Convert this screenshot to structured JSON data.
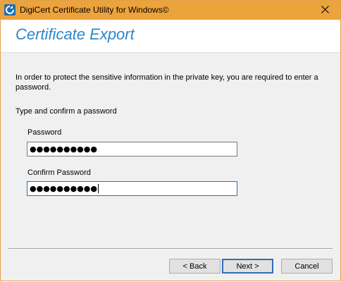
{
  "window": {
    "title": "DigiCert Certificate Utility for Windows©"
  },
  "header": {
    "title": "Certificate Export"
  },
  "body": {
    "intro": "In order to protect the sensitive information in the private key, you are required to enter a password.",
    "subhead": "Type and confirm a password",
    "password_label": "Password",
    "password_value": "●●●●●●●●●●",
    "confirm_label": "Confirm Password",
    "confirm_value": "●●●●●●●●●●"
  },
  "buttons": {
    "back": "< Back",
    "next": "Next >",
    "cancel": "Cancel"
  },
  "colors": {
    "titlebar": "#eda33c",
    "accent": "#2d87c9"
  },
  "icons": {
    "app": "digicert-logo-icon",
    "close": "close-icon"
  }
}
